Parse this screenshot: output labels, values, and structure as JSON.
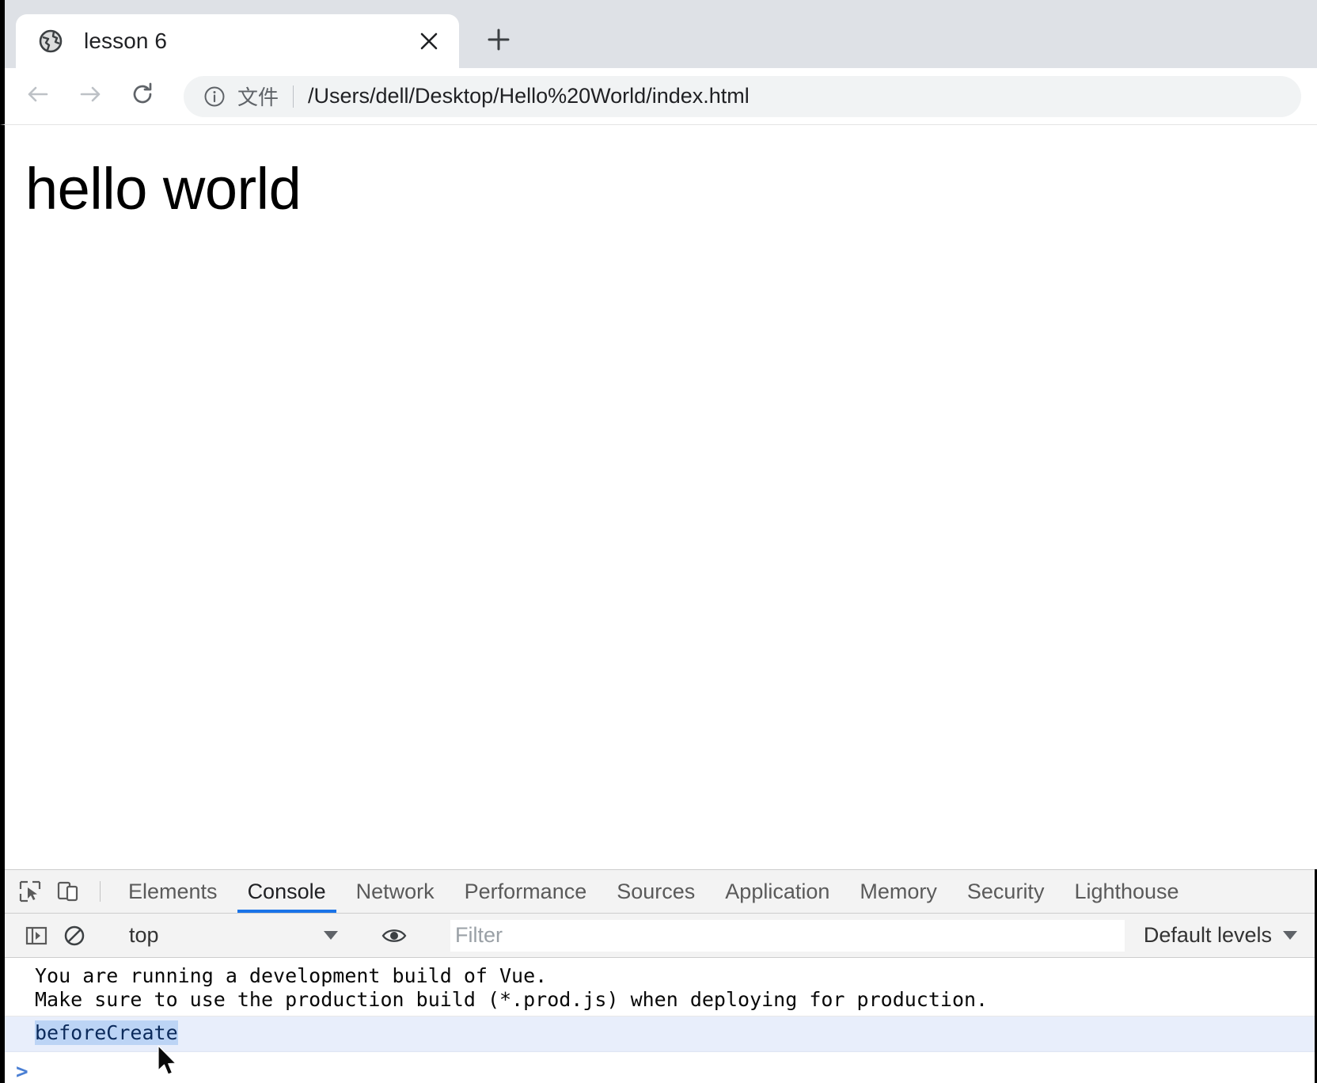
{
  "browser": {
    "tab": {
      "title": "lesson 6",
      "favicon_icon": "globe-icon",
      "close_icon": "close-icon"
    },
    "new_tab_icon": "plus-icon",
    "nav": {
      "back_icon": "arrow-left-icon",
      "forward_icon": "arrow-right-icon",
      "reload_icon": "reload-icon"
    },
    "omnibox": {
      "info_icon": "info-circle-icon",
      "scheme_label": "文件",
      "url": "/Users/dell/Desktop/Hello%20World/index.html"
    }
  },
  "page": {
    "heading": "hello world"
  },
  "devtools": {
    "inspect_icon": "inspect-element-icon",
    "device_toolbar_icon": "device-toolbar-icon",
    "tabs": [
      {
        "label": "Elements",
        "active": false
      },
      {
        "label": "Console",
        "active": true
      },
      {
        "label": "Network",
        "active": false
      },
      {
        "label": "Performance",
        "active": false
      },
      {
        "label": "Sources",
        "active": false
      },
      {
        "label": "Application",
        "active": false
      },
      {
        "label": "Memory",
        "active": false
      },
      {
        "label": "Security",
        "active": false
      },
      {
        "label": "Lighthouse",
        "active": false
      }
    ],
    "console_toolbar": {
      "sidebar_icon": "console-sidebar-icon",
      "clear_icon": "clear-console-icon",
      "context": "top",
      "eye_icon": "live-expression-icon",
      "filter_placeholder": "Filter",
      "filter_value": "",
      "levels_label": "Default levels"
    },
    "console_messages": [
      {
        "lines": [
          "You are running a development build of Vue.",
          "Make sure to use the production build (*.prod.js) when deploying for production."
        ],
        "selected": false
      },
      {
        "lines": [
          "beforeCreate"
        ],
        "selected": true
      }
    ],
    "prompt_caret": ">"
  },
  "colors": {
    "tabstrip_bg": "#dee1e6",
    "accent_blue": "#1a73e8",
    "selected_row_bg": "#e8eefb",
    "text_selection_bg": "#bcd4f5"
  }
}
